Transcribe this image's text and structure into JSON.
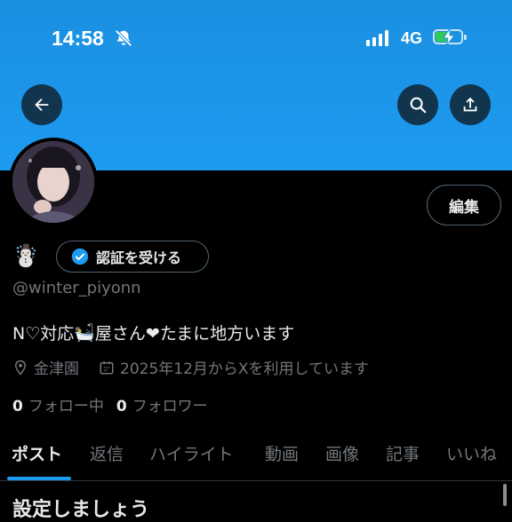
{
  "status_bar": {
    "time": "14:58",
    "network": "4G",
    "icons": [
      "bell-slash-icon",
      "signal-icon",
      "battery-charging-icon"
    ]
  },
  "header": {
    "back_icon": "arrow-left-icon",
    "search_icon": "search-icon",
    "share_icon": "share-icon"
  },
  "profile": {
    "edit_label": "編集",
    "emoji": "☃️",
    "verify_label": "認証を受ける",
    "handle": "@winter_piyonn",
    "bio_part1": "N♡対応",
    "bio_emoji": "🛀",
    "bio_part2": "屋さん❤︎たまに地方います",
    "location": "金津園",
    "joined": "2025年12月からXを利用しています",
    "following_count": "0",
    "following_label": "フォロー中",
    "followers_count": "0",
    "followers_label": "フォロワー"
  },
  "tabs": [
    {
      "label": "ポスト",
      "active": true
    },
    {
      "label": "返信",
      "active": false
    },
    {
      "label": "ハイライト",
      "active": false
    },
    {
      "label": "動画",
      "active": false
    },
    {
      "label": "画像",
      "active": false
    },
    {
      "label": "記事",
      "active": false
    },
    {
      "label": "いいね",
      "active": false
    }
  ],
  "next_section_heading": "設定しましょう",
  "colors": {
    "banner": "#1d9bf0",
    "accent": "#1d9bf0",
    "background": "#000000",
    "muted_text": "#71767b"
  }
}
